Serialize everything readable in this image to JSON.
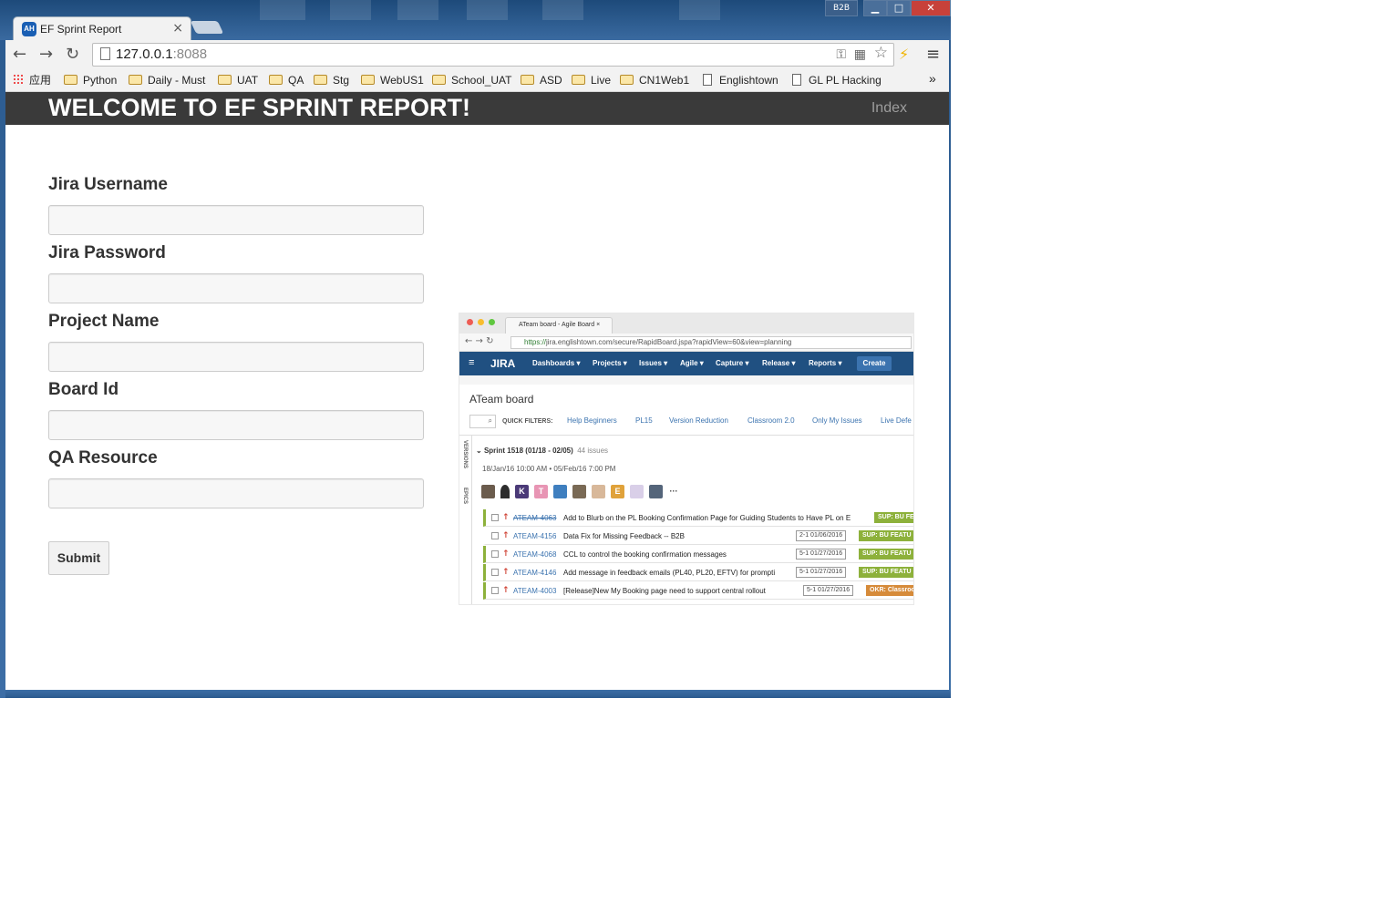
{
  "window": {
    "tray_badge": "B2B",
    "controls": {
      "minimize": "▁",
      "maximize": "□",
      "close": "✕"
    }
  },
  "tab": {
    "favicon": "AH",
    "title": "EF Sprint Report",
    "close": "×"
  },
  "toolbar": {
    "back": "←",
    "forward": "→",
    "reload": "↻",
    "url_host": "127.0.0.1",
    "url_port": ":8088",
    "menu": "≡"
  },
  "bookmarks": {
    "apps": "应用",
    "items": [
      "Python",
      "Daily - Must",
      "UAT",
      "QA",
      "Stg",
      "WebUS1",
      "School_UAT",
      "ASD",
      "Live",
      "CN1Web1",
      "Englishtown",
      "GL PL Hacking"
    ],
    "more": "»"
  },
  "page": {
    "brand": "WELCOME TO EF SPRINT REPORT!",
    "nav_index": "Index",
    "form": {
      "fields": [
        {
          "label": "Jira Username",
          "value": ""
        },
        {
          "label": "Jira Password",
          "value": ""
        },
        {
          "label": "Project Name",
          "value": ""
        },
        {
          "label": "Board Id",
          "value": ""
        },
        {
          "label": "QA Resource",
          "value": ""
        }
      ],
      "submit_label": "Submit"
    }
  },
  "jira_screenshot": {
    "tab_title": "ATeam board - Agile Board",
    "url_scheme": "https://",
    "url_rest": "jira.englishtown.com/secure/RapidBoard.jspa?rapidView=60&view=planning",
    "logo": "JIRA",
    "nav": [
      "Dashboards ▾",
      "Projects ▾",
      "Issues ▾",
      "Agile ▾",
      "Capture ▾",
      "Release ▾",
      "Reports ▾"
    ],
    "create": "Create",
    "board_title": "ATeam board",
    "quick_filters_label": "QUICK FILTERS:",
    "filters": [
      "Help Beginners",
      "PL15",
      "Version Reduction",
      "Classroom 2.0",
      "Only My Issues",
      "Live Defe"
    ],
    "sidebar": [
      "VERSIONS",
      "EPICS"
    ],
    "sprint_title": "Sprint 1518 (01/18 - 02/05)",
    "sprint_count": "44 issues",
    "sprint_dates": "18/Jan/16 10:00 AM • 05/Feb/16 7:00 PM",
    "avatars": [
      "",
      "",
      "K",
      "T",
      "",
      "",
      "",
      "E",
      "",
      "",
      "···"
    ],
    "issues": [
      {
        "key": "ATEAM-4063",
        "done": true,
        "summary": "Add to Blurb on the PL Booking Confirmation Page for Guiding Students to Have PL on E",
        "version": "",
        "epic": "SUP: BU FE"
      },
      {
        "key": "ATEAM-4156",
        "done": false,
        "summary": "Data Fix for Missing Feedback -- B2B",
        "version": "2-1 01/06/2016",
        "epic": "SUP: BU FEATU"
      },
      {
        "key": "ATEAM-4068",
        "done": false,
        "summary": "CCL to control the booking confirmation messages",
        "version": "5-1 01/27/2016",
        "epic": "SUP: BU FEATU"
      },
      {
        "key": "ATEAM-4146",
        "done": false,
        "summary": "Add message in feedback emails (PL40, PL20, EFTV) for prompti",
        "version": "5-1 01/27/2016",
        "epic": "SUP: BU FEATU"
      },
      {
        "key": "ATEAM-4003",
        "done": false,
        "summary": "[Release]New My Booking page need to support central rollout",
        "version": "5-1 01/27/2016",
        "epic": "OKR: Classroo"
      }
    ]
  },
  "colors": {
    "header_bg": "#3a3a3a",
    "jira_nav": "#205081",
    "epic_green": "#8db13b",
    "epic_orange": "#d68b3a"
  }
}
